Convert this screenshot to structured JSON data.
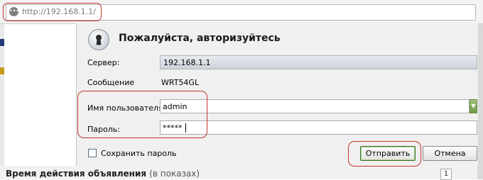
{
  "browser": {
    "url": "http://192.168.1.1/",
    "site_icon": "ellipsis-icon"
  },
  "dialog": {
    "title": "Пожалуйста, авторизуйтесь",
    "icon": "keyhole-lock-icon",
    "server_label": "Сервер:",
    "server_value": "192.168.1.1",
    "message_label": "Сообщение",
    "message_value": "WRT54GL",
    "username_label": "Имя пользователя:",
    "username_value": "admin",
    "password_label": "Пароль:",
    "password_value": "*****",
    "remember_label": "Сохранить пароль",
    "remember_checked": false,
    "submit_label": "Отправить",
    "cancel_label": "Отмена"
  },
  "background_page": {
    "bottom_text": "Время действия объявления",
    "bottom_text_muted": "(в показах)",
    "bottom_mark": "1"
  },
  "colors": {
    "highlight": "#c0392b",
    "submit_border": "#3c6f25",
    "dropdown_green": "#6f9a44"
  }
}
